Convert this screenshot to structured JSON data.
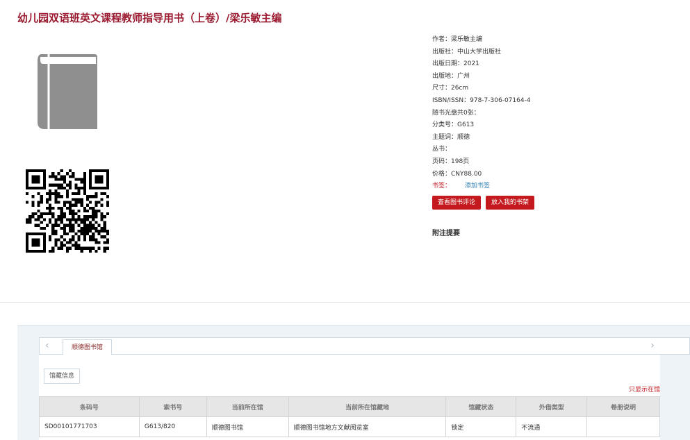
{
  "title": "幼儿园双语班英文课程教师指导用书（上卷）/梁乐敏主编",
  "details": [
    "作者：梁乐敏主编",
    "出版社：中山大学出版社",
    "出版日期：2021",
    "出版地：广州",
    "尺寸：26cm",
    "ISBN/ISSN：978-7-306-07164-4",
    "随书光盘共0张：",
    "分类号：G613",
    "主题词：顺德",
    "丛书：",
    "页码：198页",
    "价格：CNY88.00"
  ],
  "tags": {
    "label": "书签：",
    "add_label": "添加书签"
  },
  "buttons": {
    "review": "查看图书评论",
    "shelf": "放入我的书架"
  },
  "notes_title": "附注提要",
  "holdings": {
    "tab": "顺德图书馆",
    "subtab": "馆藏信息",
    "only_this_library": "只显示在馆",
    "nav_prev": "‹",
    "nav_next": "›",
    "columns": [
      "条码号",
      "索书号",
      "当前所在馆",
      "当前所在馆藏地",
      "馆藏状态",
      "外借类型",
      "卷册说明"
    ],
    "rows": [
      [
        "SD00101771703",
        "G613/820",
        "顺德图书馆",
        "顺德图书馆地方文献阅览室",
        "锁定",
        "不流通",
        ""
      ]
    ]
  },
  "icons": {
    "cover": "book-icon",
    "qr": "qr-code"
  },
  "colors": {
    "title": "#9b1b30",
    "button": "#c41a1f",
    "link": "#2a7ab0"
  }
}
